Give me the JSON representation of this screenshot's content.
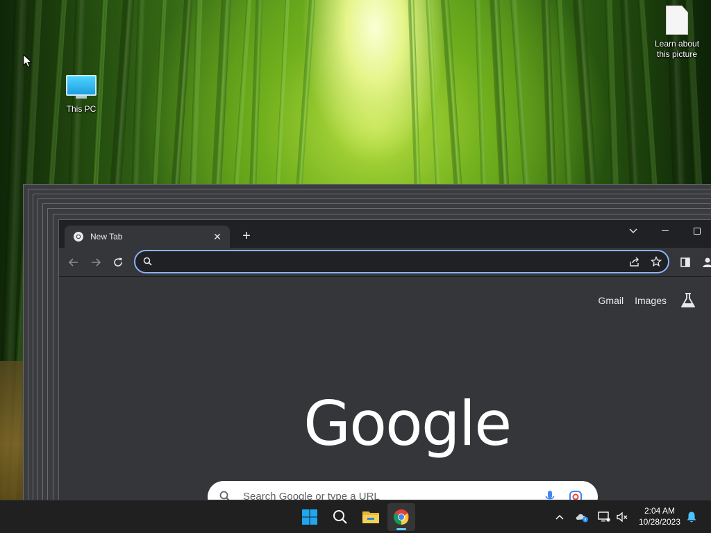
{
  "desktop": {
    "icons": [
      {
        "label": "This PC",
        "icon": "this-pc-icon"
      },
      {
        "label": "Learn about\nthis picture",
        "icon": "document-icon"
      }
    ]
  },
  "browser": {
    "tab": {
      "title": "New Tab",
      "favicon": "chrome-icon"
    },
    "omnibox": {
      "value": "",
      "placeholder": ""
    },
    "ntp": {
      "links": [
        "Gmail",
        "Images"
      ],
      "logo_text": "Google",
      "search_placeholder": "Search Google or type a URL"
    },
    "colors": {
      "frame": "#202124",
      "toolbar": "#35363a",
      "focus_ring": "#8ab4f8"
    }
  },
  "taskbar": {
    "apps": [
      "start-icon",
      "search-icon",
      "file-explorer-icon",
      "chrome-icon"
    ],
    "clock": {
      "time": "2:04 AM",
      "date": "10/28/2023"
    }
  }
}
